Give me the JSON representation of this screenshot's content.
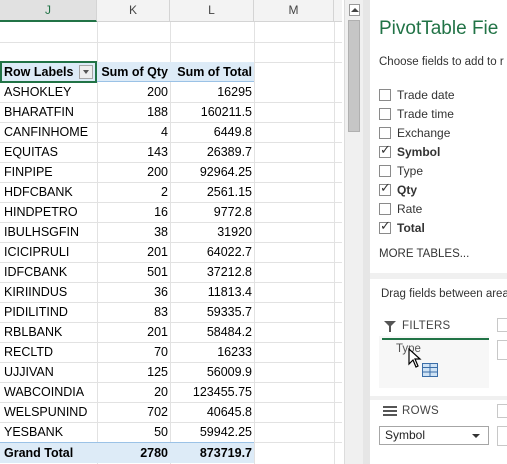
{
  "sheet": {
    "columns": [
      "J",
      "K",
      "L",
      "M"
    ],
    "active_column": "J",
    "pivot": {
      "headers": {
        "label": "Row Labels",
        "qty": "Sum of Qty",
        "total": "Sum of Total"
      },
      "rows": [
        {
          "label": "ASHOKLEY",
          "qty": "200",
          "total": "16295"
        },
        {
          "label": "BHARATFIN",
          "qty": "188",
          "total": "160211.5"
        },
        {
          "label": "CANFINHOME",
          "qty": "4",
          "total": "6449.8"
        },
        {
          "label": "EQUITAS",
          "qty": "143",
          "total": "26389.7"
        },
        {
          "label": "FINPIPE",
          "qty": "200",
          "total": "92964.25"
        },
        {
          "label": "HDFCBANK",
          "qty": "2",
          "total": "2561.15"
        },
        {
          "label": "HINDPETRO",
          "qty": "16",
          "total": "9772.8"
        },
        {
          "label": "IBULHSGFIN",
          "qty": "38",
          "total": "31920"
        },
        {
          "label": "ICICIPRULI",
          "qty": "201",
          "total": "64022.7"
        },
        {
          "label": "IDFCBANK",
          "qty": "501",
          "total": "37212.8"
        },
        {
          "label": "KIRIINDUS",
          "qty": "36",
          "total": "11813.4"
        },
        {
          "label": "PIDILITIND",
          "qty": "83",
          "total": "59335.7"
        },
        {
          "label": "RBLBANK",
          "qty": "201",
          "total": "58484.2"
        },
        {
          "label": "RECLTD",
          "qty": "70",
          "total": "16233"
        },
        {
          "label": "UJJIVAN",
          "qty": "125",
          "total": "56009.9"
        },
        {
          "label": "WABCOINDIA",
          "qty": "20",
          "total": "123455.75"
        },
        {
          "label": "WELSPUNIND",
          "qty": "702",
          "total": "40645.8"
        },
        {
          "label": "YESBANK",
          "qty": "50",
          "total": "59942.25"
        }
      ],
      "grand_total": {
        "label": "Grand Total",
        "qty": "2780",
        "total": "873719.7"
      }
    }
  },
  "pane": {
    "title": "PivotTable Fie",
    "subtitle": "Choose fields to add to r",
    "fields": [
      {
        "label": "Trade date",
        "checked": false
      },
      {
        "label": "Trade time",
        "checked": false
      },
      {
        "label": "Exchange",
        "checked": false
      },
      {
        "label": "Symbol",
        "checked": true
      },
      {
        "label": "Type",
        "checked": false
      },
      {
        "label": "Qty",
        "checked": true
      },
      {
        "label": "Rate",
        "checked": false
      },
      {
        "label": "Total",
        "checked": true
      }
    ],
    "more_tables": "MORE TABLES...",
    "drag_text": "Drag fields between area",
    "filters_label": "FILTERS",
    "dragging_field": "Type",
    "rows_label": "ROWS",
    "rows_value": "Symbol"
  },
  "colors": {
    "accent": "#217346",
    "pivot_header_bg": "#ddebf7",
    "pivot_header_border": "#9bc2e6"
  }
}
